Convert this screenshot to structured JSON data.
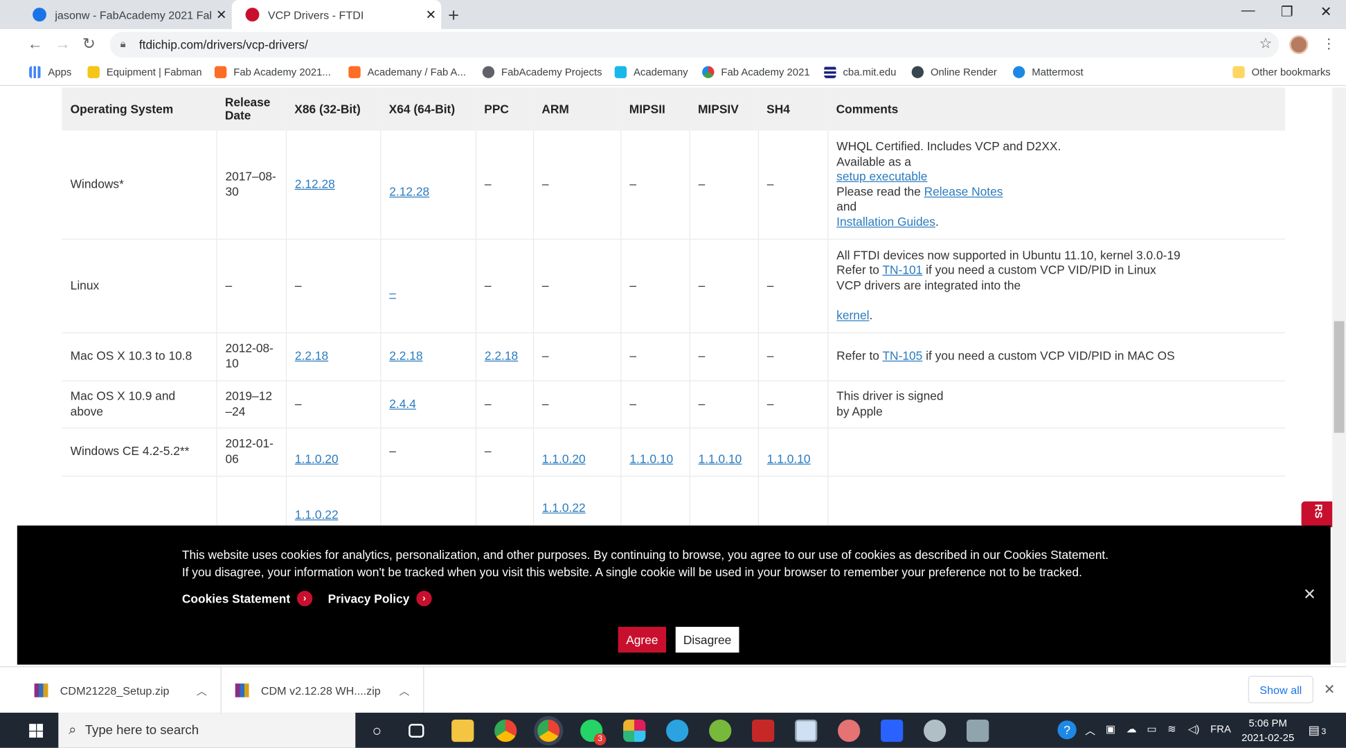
{
  "browser": {
    "tabs": [
      {
        "title": "jasonw - FabAcademy 2021 Fab...",
        "active": false
      },
      {
        "title": "VCP Drivers - FTDI",
        "active": true
      }
    ],
    "url": "ftdichip.com/drivers/vcp-drivers/",
    "bookmarks": [
      "Apps",
      "Equipment | Fabman",
      "Fab Academy 2021...",
      "Academany / Fab A...",
      "FabAcademy Projects",
      "Academany",
      "Fab Academy 2021",
      "cba.mit.edu",
      "Online Render",
      "Mattermost",
      "Other bookmarks"
    ]
  },
  "table": {
    "headers": [
      "Operating System",
      "Release Date",
      "X86 (32-Bit)",
      "X64 (64-Bit)",
      "PPC",
      "ARM",
      "MIPSII",
      "MIPSIV",
      "SH4",
      "Comments"
    ],
    "rows": [
      {
        "os": "Windows*",
        "date": "2017–08-30",
        "x86": "2.12.28",
        "x64": "2.12.28",
        "ppc": "–",
        "arm": "–",
        "mipsii": "–",
        "mipsiv": "–",
        "sh4": "–",
        "comment_1": "WHQL Certified. Includes VCP and D2XX.",
        "comment_2": "Available as a",
        "comment_link_1": "setup executable",
        "comment_3": "Please read the",
        "comment_link_2": "Release Notes",
        "comment_4": "and",
        "comment_link_3": "Installation Guides",
        "comment_5": "."
      },
      {
        "os": "Linux",
        "date": "–",
        "x86": "–",
        "x64": "–",
        "ppc": "–",
        "arm": "–",
        "mipsii": "–",
        "mipsiv": "–",
        "sh4": "–",
        "comment_1": "All FTDI devices now supported in Ubuntu 11.10, kernel 3.0.0-19",
        "comment_2": "Refer to",
        "comment_link_1": "TN-101",
        "comment_3": "if you need a custom VCP VID/PID in Linux",
        "comment_4": "VCP drivers are integrated into the",
        "comment_link_2": "kernel",
        "comment_5": "."
      },
      {
        "os": "Mac OS X 10.3 to 10.8",
        "date": "2012-08-10",
        "x86": "2.2.18",
        "x64": "2.2.18",
        "ppc": "2.2.18",
        "arm": "–",
        "mipsii": "–",
        "mipsiv": "–",
        "sh4": "–",
        "comment_1": "Refer to",
        "comment_link_1": "TN-105",
        "comment_2": "if you need a custom VCP VID/PID in MAC OS"
      },
      {
        "os": "Mac OS X 10.9 and above",
        "date": "2019–12–24",
        "x86": "–",
        "x64": "2.4.4",
        "ppc": "–",
        "arm": "–",
        "mipsii": "–",
        "mipsiv": "–",
        "sh4": "–",
        "comment_1": "This driver is signed",
        "comment_2": "by Apple"
      },
      {
        "os": "Windows CE 4.2-5.2**",
        "date": "2012-01-06",
        "x86": "1.1.0.20",
        "x64": "–",
        "ppc": "–",
        "arm": "1.1.0.20",
        "mipsii": "1.1.0.10",
        "mipsiv": "1.1.0.10",
        "sh4": "1.1.0.10"
      },
      {
        "os": "",
        "date": "",
        "x86": "1.1.0.22",
        "arm": "1.1.0.22"
      }
    ]
  },
  "side_badge": "RS",
  "cookie": {
    "line1": "This website uses cookies for analytics, personalization, and other purposes. By continuing to browse, you agree to our use of cookies as described in our Cookies Statement.",
    "line2": "If you disagree, your information won't be tracked when you visit this website. A single cookie will be used in your browser to remember your preference not to be tracked.",
    "cookies_statement": "Cookies Statement",
    "privacy_policy": "Privacy Policy",
    "agree": "Agree",
    "disagree": "Disagree"
  },
  "downloads": {
    "items": [
      "CDM21228_Setup.zip",
      "CDM v2.12.28 WH....zip"
    ],
    "show_all": "Show all"
  },
  "taskbar": {
    "search_placeholder": "Type here to search",
    "whatsapp_badge": "3",
    "language": "FRA",
    "time": "5:06 PM",
    "date": "2021-02-25",
    "notifications": "3"
  },
  "colors": {
    "link": "#2a7bbf",
    "accent_red": "#c8102e",
    "taskbar": "#1f2733"
  }
}
